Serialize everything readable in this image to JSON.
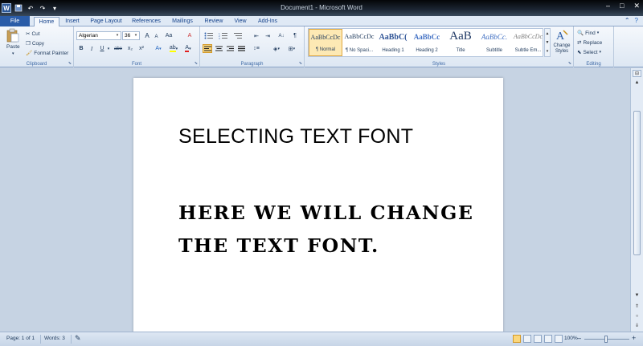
{
  "window": {
    "title": "Document1 - Microsoft Word",
    "qat_undo": "↶",
    "qat_redo": "↷",
    "minimize": "–",
    "maximize": "□",
    "close": "✕"
  },
  "tabs": [
    {
      "label": "File"
    },
    {
      "label": "Home"
    },
    {
      "label": "Insert"
    },
    {
      "label": "Page Layout"
    },
    {
      "label": "References"
    },
    {
      "label": "Mailings"
    },
    {
      "label": "Review"
    },
    {
      "label": "View"
    },
    {
      "label": "Add-Ins"
    }
  ],
  "ribbon": {
    "clipboard": {
      "label": "Clipboard",
      "paste": "Paste",
      "cut": "Cut",
      "copy": "Copy",
      "format_painter": "Format Painter"
    },
    "font": {
      "label": "Font",
      "font_name": "Algerian",
      "font_size": "36",
      "bold": "B",
      "italic": "I",
      "underline": "U",
      "strike": "abe",
      "subscript": "x₂",
      "superscript": "x²",
      "grow": "A",
      "shrink": "A",
      "change_case": "Aa",
      "clear": "A",
      "highlight": "ab",
      "font_color": "A"
    },
    "paragraph": {
      "label": "Paragraph",
      "show_marks": "¶",
      "sort": "A↓"
    },
    "styles": {
      "label": "Styles",
      "items": [
        {
          "preview": "AaBbCcDc",
          "name": "¶ Normal"
        },
        {
          "preview": "AaBbCcDc",
          "name": "¶ No Spaci..."
        },
        {
          "preview": "AaBbC(",
          "name": "Heading 1"
        },
        {
          "preview": "AaBbCc",
          "name": "Heading 2"
        },
        {
          "preview": "AaB",
          "name": "Title"
        },
        {
          "preview": "AaBbCc.",
          "name": "Subtitle"
        },
        {
          "preview": "AaBbCcDc",
          "name": "Subtle Em..."
        }
      ],
      "change_styles": "Change Styles"
    },
    "editing": {
      "label": "Editing",
      "find": "Find",
      "replace": "Replace",
      "select": "Select"
    }
  },
  "document": {
    "heading": "SELECTING TEXT FONT",
    "body_line1": "HERE WE WILL CHANGE",
    "body_line2": "THE TEXT FONT."
  },
  "status": {
    "page": "Page: 1 of 1",
    "words": "Words: 3",
    "zoom": "100%",
    "zoom_out": "–",
    "zoom_in": "+"
  },
  "colors": {
    "file_tab": "#2a5ca8",
    "ribbon_bg": "#dde7f3",
    "highlight_color": "#ffff00",
    "font_color": "#e02020"
  }
}
